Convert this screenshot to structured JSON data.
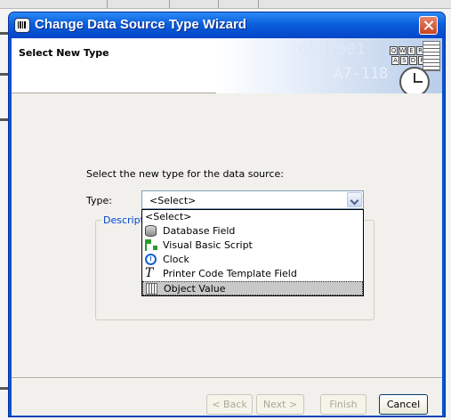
{
  "window": {
    "title": "Change Data Source Type Wizard"
  },
  "banner": {
    "title": "Select New Type",
    "art_text_1": "6597001",
    "art_text_2": "A7-118",
    "keyboard_row_1": [
      "Q",
      "W",
      "E",
      "R",
      "T"
    ],
    "keyboard_row_2": [
      "A",
      "S",
      "D",
      "F",
      "G"
    ]
  },
  "form": {
    "prompt": "Select the new type for the data source:",
    "type_label": "Type:",
    "type_value": "<Select>",
    "description_legend": "Descripti"
  },
  "dropdown": {
    "options": [
      {
        "label": "<Select>",
        "icon": null
      },
      {
        "label": "Database Field",
        "icon": "database-icon"
      },
      {
        "label": "Visual Basic Script",
        "icon": "script-icon"
      },
      {
        "label": "Clock",
        "icon": "clock-icon"
      },
      {
        "label": "Printer Code Template Field",
        "icon": "text-t-icon"
      },
      {
        "label": "Object Value",
        "icon": "object-value-icon"
      }
    ],
    "highlighted_index": 5
  },
  "buttons": {
    "back": "< Back",
    "next": "Next >",
    "finish": "Finish",
    "cancel": "Cancel"
  },
  "colors": {
    "titlebar": "#0a5fdc",
    "description_legend": "#0046d5",
    "close_button": "#c8451f"
  }
}
